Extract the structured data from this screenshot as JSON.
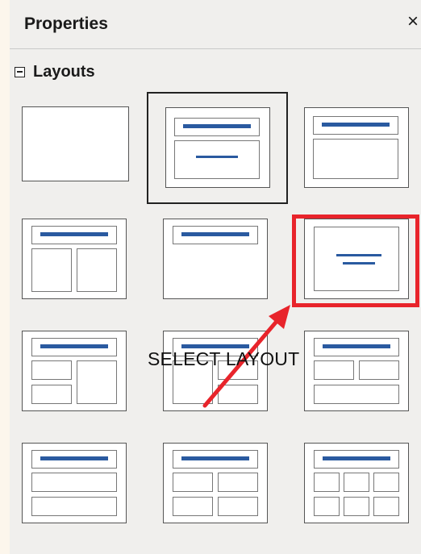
{
  "panel": {
    "title": "Properties",
    "close_glyph": "×"
  },
  "section": {
    "label": "Layouts",
    "collapse_icon": "minus-box-icon"
  },
  "layouts": [
    {
      "name": "blank-slide",
      "selected": false
    },
    {
      "name": "title-content",
      "selected": true
    },
    {
      "name": "title-content-2",
      "selected": false
    },
    {
      "name": "title-two-content",
      "selected": false
    },
    {
      "name": "title-only",
      "selected": false
    },
    {
      "name": "centered-text",
      "selected": false,
      "highlighted": true
    },
    {
      "name": "title-2content-content",
      "selected": false
    },
    {
      "name": "title-content-2content",
      "selected": false
    },
    {
      "name": "title-2content-over-content",
      "selected": false
    },
    {
      "name": "title-content-over-content",
      "selected": false
    },
    {
      "name": "title-4-content",
      "selected": false
    },
    {
      "name": "title-6-content",
      "selected": false
    }
  ],
  "annotation": {
    "text": "SELECT LAYOUT",
    "highlight_color": "#e8242b",
    "arrow_color": "#e8242b"
  },
  "colors": {
    "accent_bar": "#2a5aa0",
    "panel_bg": "#f0efed"
  }
}
